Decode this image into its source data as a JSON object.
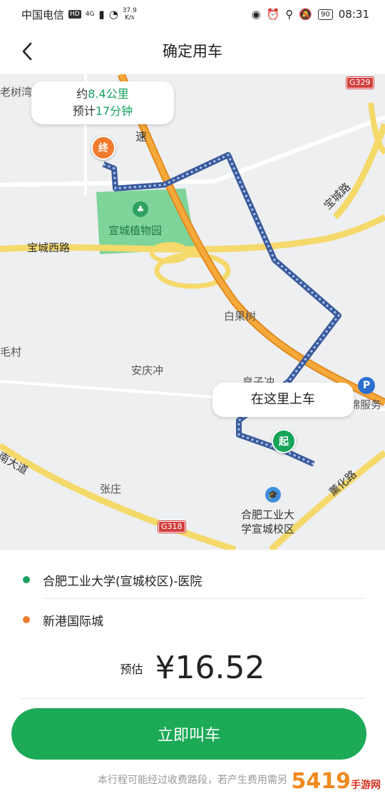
{
  "status_bar": {
    "carrier": "中国电信",
    "hd": "HD",
    "network": "4G",
    "speed_value": "37.9",
    "speed_unit": "K/s",
    "battery": "90",
    "time": "08:31"
  },
  "header": {
    "title": "确定用车"
  },
  "map": {
    "route_bubble": {
      "prefix1": "约",
      "distance": "8.4公里",
      "prefix2": "预计",
      "duration": "17分钟"
    },
    "pickup_bubble": "在这里上车",
    "end_marker": "终",
    "start_marker": "起",
    "labels": {
      "laoshuwan": "老树湾",
      "g329": "G329",
      "su": "速",
      "xuancheng_lu": "宝城路",
      "botanical_garden": "宣城植物园",
      "xuancheng_xilu": "宝城西路",
      "baiguoshu": "白果树",
      "maocun": "毛村",
      "anqingchong": "安庆冲",
      "huangzichong": "皇子冲",
      "jinfuwu": "锦服务",
      "nandadao": "南大道",
      "zhangzhuang": "张庄",
      "xunhualu": "薰化路",
      "hfut": "合肥工业大",
      "hfut2": "学宣城校区",
      "g318": "G318"
    }
  },
  "trip": {
    "origin": "合肥工业大学(宣城校区)-医院",
    "destination": "新港国际城",
    "estimate_label": "预估",
    "price": "¥16.52",
    "cta": "立即叫车",
    "notice": "本行程可能经过收费路段，若产生费用需另",
    "watermark_main": "5419",
    "watermark_sub": "手游网"
  },
  "colors": {
    "accent_green": "#1caa57",
    "origin_dot": "#1aa260",
    "destination_dot": "#f07b2f",
    "highway": "#f29b2d",
    "road_yellow": "#f5d96b",
    "park": "#7fd49a",
    "route": "#4a6fb5"
  }
}
